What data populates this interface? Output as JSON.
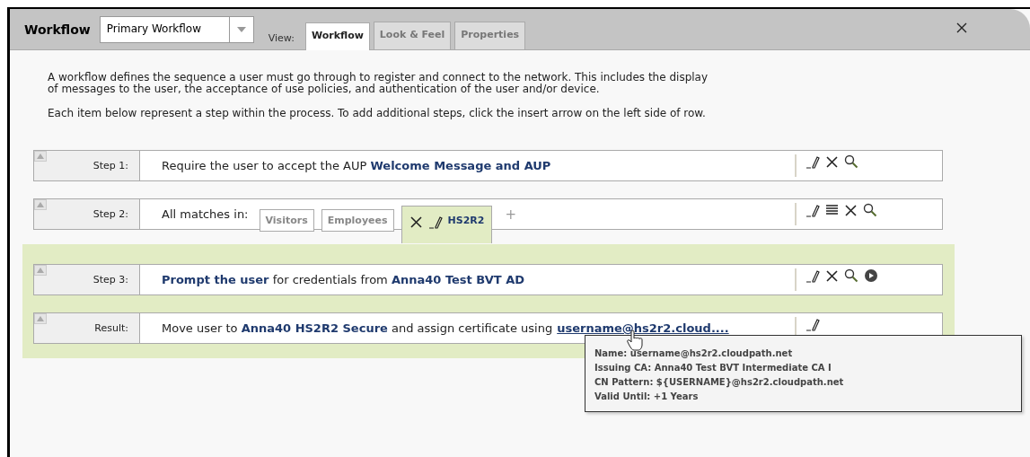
{
  "header": {
    "title": "Workflow",
    "workflow_select": {
      "value": "Primary Workflow"
    },
    "view_label": "View:",
    "tabs": [
      {
        "label": "Workflow",
        "selected": true
      },
      {
        "label": "Look & Feel",
        "selected": false
      },
      {
        "label": "Properties",
        "selected": false
      }
    ]
  },
  "intro": [
    "A workflow defines the sequence a user must go through to register and connect to the network. This includes the display of messages to the user, the acceptance of use policies, and authentication of the user and/or device.",
    "Each item below represent a step within the process. To add additional steps, click the insert arrow on the left side of row."
  ],
  "steps": [
    {
      "kind": "text",
      "label": "Step 1:",
      "text": "Require the user to accept the AUP **Welcome Message and AUP**",
      "actions": [
        {
          "kind": "edit"
        },
        {
          "kind": "delete"
        },
        {
          "kind": "search"
        }
      ]
    },
    {
      "kind": "branches",
      "label": "Step 2:",
      "text": "All matches in:",
      "branches": [
        {
          "label": "Visitors",
          "selected": false
        },
        {
          "label": "Employees",
          "selected": false
        },
        {
          "label": "HS2R2",
          "selected": true
        }
      ],
      "add": "+",
      "actions": [
        {
          "kind": "edit"
        },
        {
          "kind": "list"
        },
        {
          "kind": "delete"
        },
        {
          "kind": "search"
        }
      ]
    }
  ],
  "branch_steps": [
    {
      "kind": "text",
      "label": "Step 3:",
      "text": "**Prompt the user** for credentials from **Anna40 Test BVT AD**",
      "actions": [
        {
          "kind": "edit"
        },
        {
          "kind": "delete"
        },
        {
          "kind": "search"
        },
        {
          "kind": "play"
        }
      ]
    },
    {
      "kind": "result",
      "label": "Result:",
      "text": "Move user to **Anna40 HS2R2 Secure** and assign certificate using",
      "link": "username@hs2r2.cloud....",
      "actions": [
        {
          "kind": "edit"
        }
      ],
      "tooltip": [
        "Name: username@hs2r2.cloudpath.net",
        "Issuing CA: Anna40 Test BVT Intermediate CA I",
        "CN Pattern: ${USERNAME}@hs2r2.cloudpath.net",
        "Valid Until: +1 Years"
      ]
    }
  ]
}
